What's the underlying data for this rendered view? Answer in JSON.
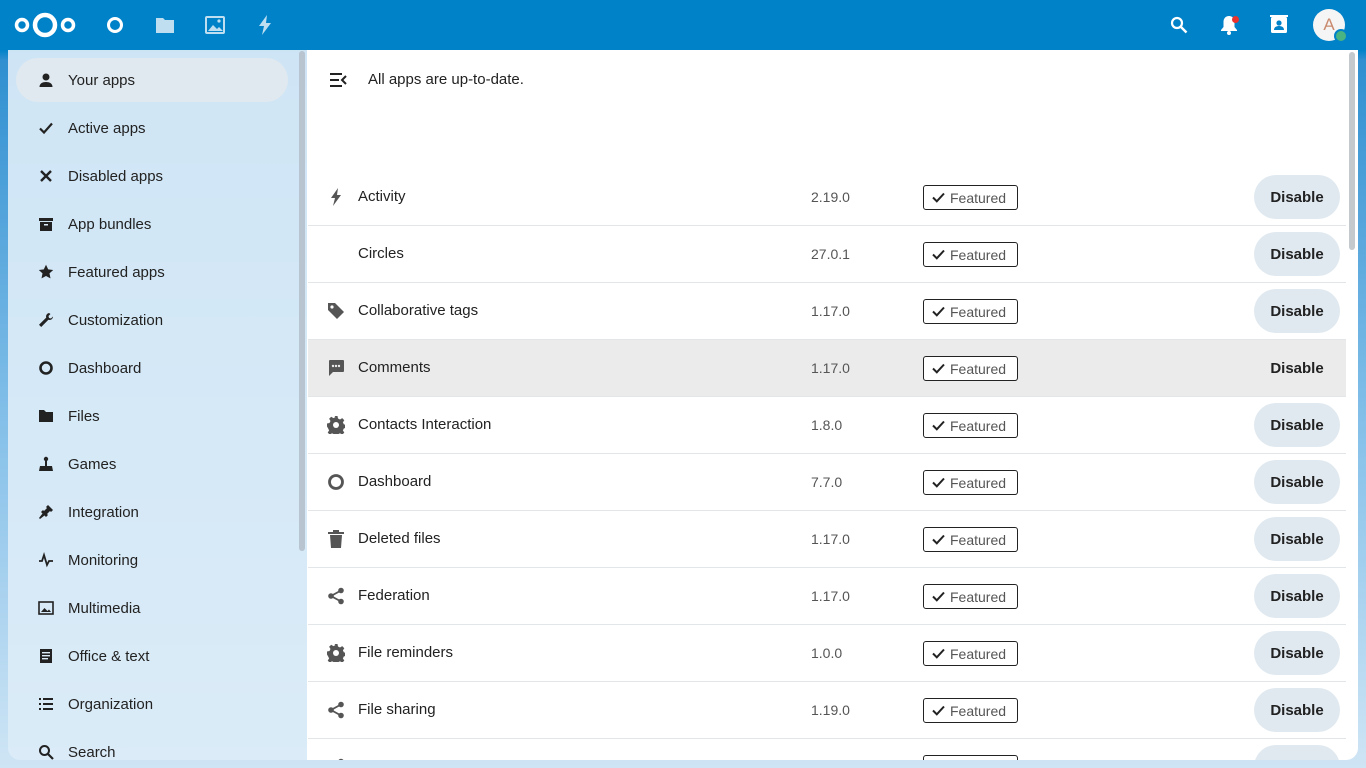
{
  "header": {
    "nav_icons": [
      "dashboard-icon",
      "files-icon",
      "photos-icon",
      "activity-icon"
    ],
    "right_icons": [
      "search-icon",
      "notifications-icon",
      "contacts-icon"
    ],
    "avatar_letter": "A",
    "colors": {
      "brand": "#0082c9",
      "status_online": "#49b382",
      "notification": "#e9322d"
    }
  },
  "sidebar": {
    "items": [
      {
        "label": "Your apps",
        "icon": "user-icon",
        "active": true
      },
      {
        "label": "Active apps",
        "icon": "check-icon"
      },
      {
        "label": "Disabled apps",
        "icon": "close-icon"
      },
      {
        "label": "App bundles",
        "icon": "archive-icon"
      },
      {
        "label": "Featured apps",
        "icon": "star-icon"
      },
      {
        "label": "Customization",
        "icon": "wrench-icon"
      },
      {
        "label": "Dashboard",
        "icon": "circle-icon"
      },
      {
        "label": "Files",
        "icon": "folder-icon"
      },
      {
        "label": "Games",
        "icon": "joystick-icon"
      },
      {
        "label": "Integration",
        "icon": "plug-icon"
      },
      {
        "label": "Monitoring",
        "icon": "pulse-icon"
      },
      {
        "label": "Multimedia",
        "icon": "image-icon"
      },
      {
        "label": "Office & text",
        "icon": "document-icon"
      },
      {
        "label": "Organization",
        "icon": "list-icon"
      },
      {
        "label": "Search",
        "icon": "search-icon"
      }
    ]
  },
  "main": {
    "status": "All apps are up-to-date.",
    "featured_label": "Featured",
    "disable_label": "Disable",
    "apps": [
      {
        "name": "Activity",
        "version": "2.19.0",
        "icon": "lightning-icon"
      },
      {
        "name": "Circles",
        "version": "27.0.1",
        "icon": ""
      },
      {
        "name": "Collaborative tags",
        "version": "1.17.0",
        "icon": "tag-icon"
      },
      {
        "name": "Comments",
        "version": "1.17.0",
        "icon": "comment-icon",
        "hover": true
      },
      {
        "name": "Contacts Interaction",
        "version": "1.8.0",
        "icon": "gear-icon"
      },
      {
        "name": "Dashboard",
        "version": "7.7.0",
        "icon": "circle-icon"
      },
      {
        "name": "Deleted files",
        "version": "1.17.0",
        "icon": "trash-icon"
      },
      {
        "name": "Federation",
        "version": "1.17.0",
        "icon": "share-icon"
      },
      {
        "name": "File reminders",
        "version": "1.0.0",
        "icon": "gear-icon"
      },
      {
        "name": "File sharing",
        "version": "1.19.0",
        "icon": "share-icon"
      },
      {
        "name": "",
        "version": "",
        "icon": "share-icon"
      }
    ]
  }
}
